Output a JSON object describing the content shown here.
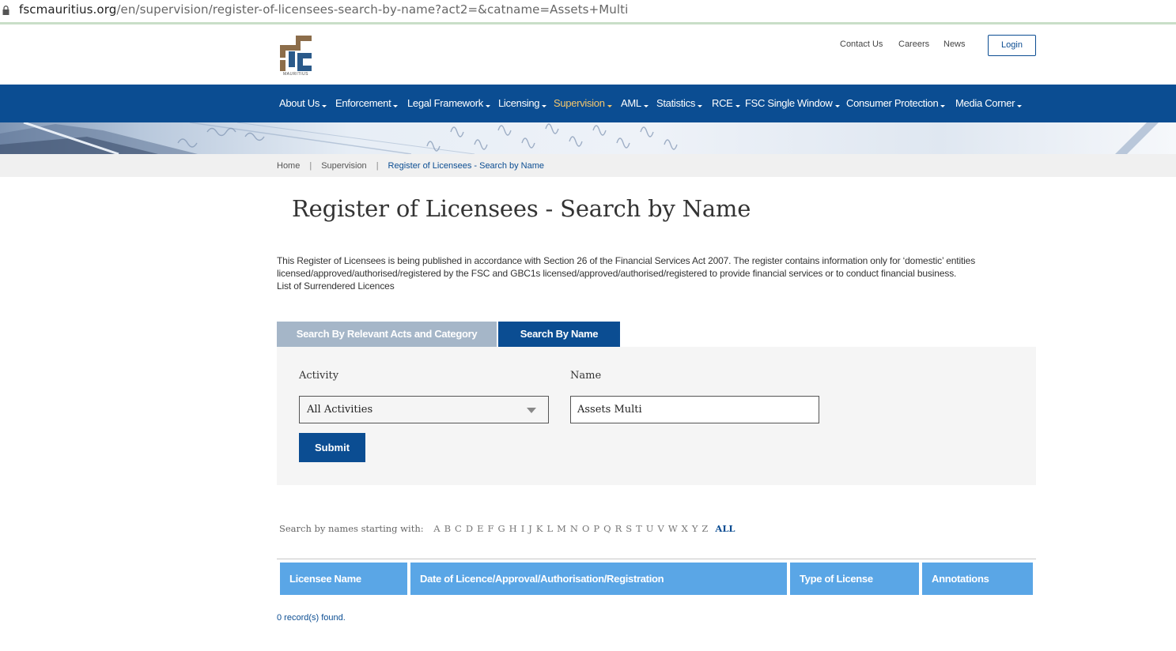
{
  "browser": {
    "url_domain": "fscmauritius.org",
    "url_path": "/en/supervision/register-of-licensees-search-by-name?act2=&catname=Assets+Multi"
  },
  "header": {
    "logo_text": "MAURITIUS",
    "links": [
      "Contact Us",
      "Careers",
      "News"
    ],
    "login_label": "Login"
  },
  "nav": {
    "items": [
      {
        "label": "About Us",
        "active": false
      },
      {
        "label": "Enforcement",
        "active": false
      },
      {
        "label": "Legal Framework",
        "active": false
      },
      {
        "label": "Licensing",
        "active": false
      },
      {
        "label": "Supervision",
        "active": true
      },
      {
        "label": "AML",
        "active": false
      },
      {
        "label": "Statistics",
        "active": false
      },
      {
        "label": "RCE",
        "active": false
      },
      {
        "label": "FSC Single Window",
        "active": false
      },
      {
        "label": "Consumer Protection",
        "active": false
      },
      {
        "label": "Media Corner",
        "active": false
      }
    ]
  },
  "breadcrumb": {
    "home": "Home",
    "section": "Supervision",
    "current": "Register of Licensees - Search by Name",
    "separator": "|"
  },
  "page": {
    "title": "Register of Licensees - Search by Name",
    "intro_line1": "This Register of Licensees is being published in accordance with Section 26 of the Financial Services Act 2007. The register contains information only for ‘domestic’ entities",
    "intro_line2": "licensed/approved/authorised/registered by the FSC and GBC1s licensed/approved/authorised/registered to provide financial services or to conduct financial business.",
    "surrendered_link": "List of Surrendered Licences"
  },
  "tabs": {
    "relevant_acts": "Search By Relevant Acts and Category",
    "by_name": "Search By Name"
  },
  "form": {
    "activity_label": "Activity",
    "activity_value": "All Activities",
    "name_label": "Name",
    "name_value": "Assets Multi",
    "submit_label": "Submit"
  },
  "alphabet": {
    "prompt": "Search by names starting with:",
    "letters": [
      "A",
      "B",
      "C",
      "D",
      "E",
      "F",
      "G",
      "H",
      "I",
      "J",
      "K",
      "L",
      "M",
      "N",
      "O",
      "P",
      "Q",
      "R",
      "S",
      "T",
      "U",
      "V",
      "W",
      "X",
      "Y",
      "Z"
    ],
    "all_label": "ALL"
  },
  "results": {
    "columns": [
      "Licensee Name",
      "Date of Licence/Approval/Authorisation/Registration",
      "Type of License",
      "Annotations"
    ],
    "records_text": "0 record(s) found."
  },
  "colors": {
    "brand_blue": "#0b4d92",
    "active_nav": "#f5c76c",
    "table_header": "#5aa6e6",
    "inactive_tab": "#a5b6c8"
  }
}
